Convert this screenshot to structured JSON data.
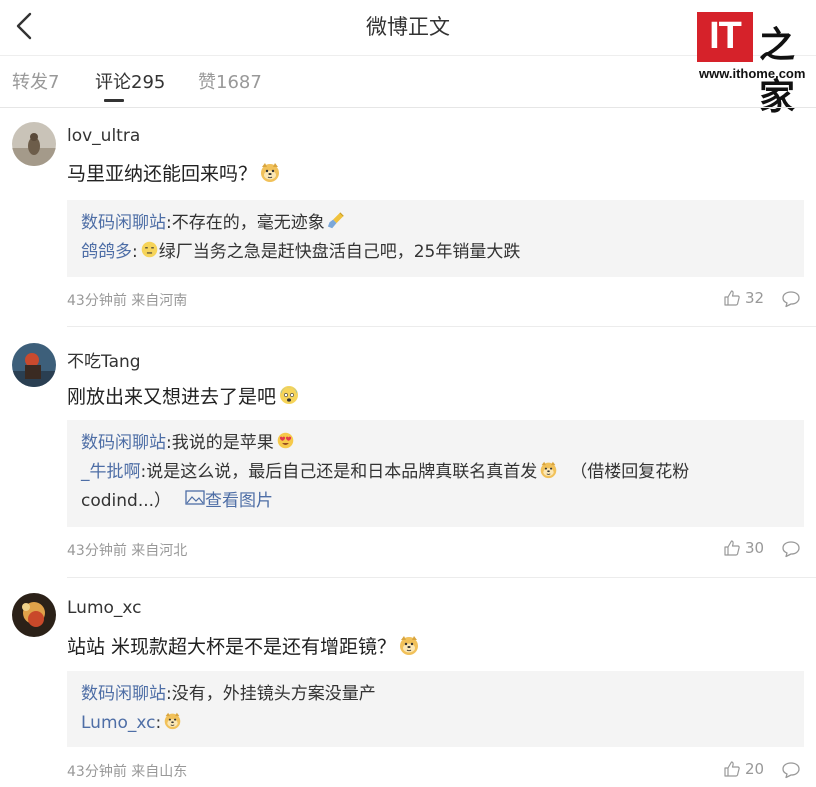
{
  "header": {
    "title": "微博正文",
    "watermark_logo": "IT之家",
    "watermark_url": "www.ithome.com"
  },
  "tabs": [
    {
      "label": "转发7",
      "active": false
    },
    {
      "label": "评论295",
      "active": true
    },
    {
      "label": "赞1687",
      "active": false
    }
  ],
  "comments": [
    {
      "username": "lov_ultra",
      "text": "马里亚纳还能回来吗？",
      "emoji": "doge",
      "replies": [
        {
          "user": "数码闲聊站",
          "text": ":不存在的，毫无迹象",
          "emoji": "sweep"
        },
        {
          "user": "鸽鸽多",
          "emoji_before": "face",
          "text": "绿厂当务之急是赶快盘活自己吧，25年销量大跌"
        }
      ],
      "time": "43分钟前",
      "location": "来自河南",
      "likes": "32"
    },
    {
      "username": "不吃Tang",
      "text": "刚放出来又想进去了是吧",
      "emoji": "scared",
      "replies": [
        {
          "user": "数码闲聊站",
          "text": ":我说的是苹果",
          "emoji": "heart-eyes"
        },
        {
          "user": "_牛批啊",
          "text": ":说是这么说，最后自己还是和日本品牌真联名真首发",
          "emoji": "doge",
          "suffix": "（借楼回复花粉"
        },
        {
          "text": "codind...）",
          "view_image": "查看图片"
        }
      ],
      "time": "43分钟前",
      "location": "来自河北",
      "likes": "30"
    },
    {
      "username": "Lumo_xc",
      "text": "站站 米现款超大杯是不是还有增距镜？",
      "emoji": "doge",
      "replies": [
        {
          "user": "数码闲聊站",
          "text": ":没有，外挂镜头方案没量产"
        },
        {
          "user": "Lumo_xc",
          "text": ":",
          "emoji": "doge"
        }
      ],
      "time": "43分钟前",
      "location": "来自山东",
      "likes": "20"
    }
  ],
  "colors": {
    "link": "#4e6ea6",
    "meta": "#999999",
    "reply_bg": "#f4f4f4",
    "watermark_red": "#d6222a"
  }
}
